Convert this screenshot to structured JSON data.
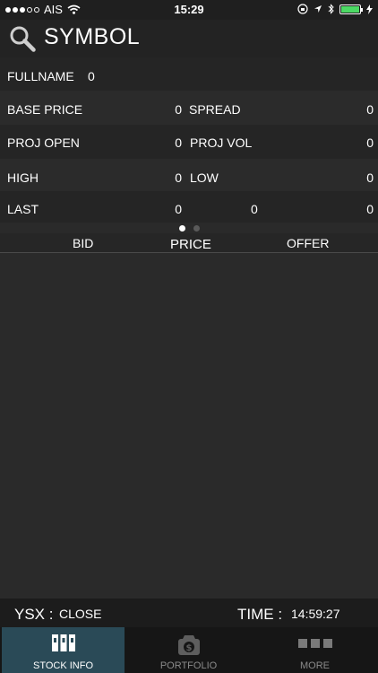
{
  "status_bar": {
    "carrier": "AIS",
    "time": "15:29"
  },
  "header": {
    "title": "SYMBOL"
  },
  "info": {
    "fullname_label": "FULLNAME",
    "fullname_value": "0",
    "base_price_label": "BASE PRICE",
    "base_price_value": "0",
    "spread_label": "SPREAD",
    "spread_value": "0",
    "proj_open_label": "PROJ OPEN",
    "proj_open_value": "0",
    "proj_vol_label": "PROJ VOL",
    "proj_vol_value": "0",
    "high_label": "HIGH",
    "high_value": "0",
    "low_label": "LOW",
    "low_value": "0",
    "last_label": "LAST",
    "last_value_1": "0",
    "last_value_2": "0",
    "last_value_3": "0"
  },
  "pager": {
    "pages": 2,
    "active": 0
  },
  "book": {
    "bid_label": "BID",
    "price_label": "PRICE",
    "offer_label": "OFFER"
  },
  "market": {
    "exchange_label": "YSX :",
    "exchange_status": "CLOSE",
    "time_label": "TIME :",
    "time_value": "14:59:27"
  },
  "tabs": [
    {
      "label": "STOCK INFO",
      "icon": "stock-info-icon",
      "active": true
    },
    {
      "label": "PORTFOLIO",
      "icon": "portfolio-icon",
      "active": false
    },
    {
      "label": "MORE",
      "icon": "more-icon",
      "active": false
    }
  ],
  "colors": {
    "active_tab": "#2a4a57",
    "battery": "#4cd964",
    "inactive_tab_text": "#8a8a8a"
  }
}
